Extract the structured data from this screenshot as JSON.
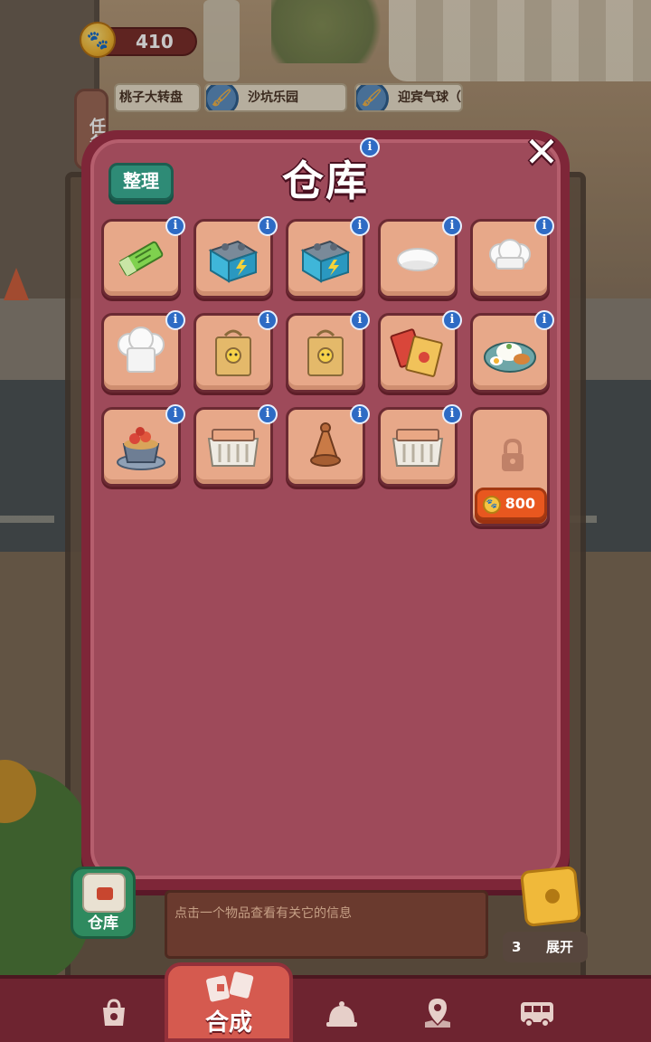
{
  "hud": {
    "coins": "410"
  },
  "tasks": {
    "tab_label": "任务",
    "banners": [
      {
        "label": "桃子大转盘"
      },
      {
        "label": "沙坑乐园"
      },
      {
        "label": "迎宾气球（左"
      }
    ]
  },
  "warehouse": {
    "title": "仓库",
    "sort_label": "整理",
    "close_label": "✕",
    "info_glyph": "i",
    "items": [
      {
        "name": "gum-pack-item-icon"
      },
      {
        "name": "battery-box-item-icon"
      },
      {
        "name": "battery-box-item-icon"
      },
      {
        "name": "chef-hat-small-item-icon"
      },
      {
        "name": "chef-hat-medium-item-icon"
      },
      {
        "name": "chef-hat-large-item-icon"
      },
      {
        "name": "takeout-bag-item-icon"
      },
      {
        "name": "takeout-bag-item-icon"
      },
      {
        "name": "pepper-packets-item-icon"
      },
      {
        "name": "rice-meal-plate-item-icon"
      },
      {
        "name": "fruit-tart-item-icon"
      },
      {
        "name": "storage-crate-item-icon"
      },
      {
        "name": "clay-lid-item-icon"
      },
      {
        "name": "storage-crate-item-icon"
      }
    ],
    "locked_slot": {
      "unlock_cost": "800"
    }
  },
  "bottom": {
    "warehouse_button_label": "仓库",
    "info_hint": "点击一个物品查看有关它的信息",
    "expand_count": "3",
    "expand_label": "展开"
  },
  "nav": {
    "active_label": "合成",
    "items": [
      {
        "name": "shop-bag-icon"
      },
      {
        "name": "merge-icon"
      },
      {
        "name": "service-bell-icon"
      },
      {
        "name": "map-pin-icon"
      },
      {
        "name": "bus-icon"
      }
    ]
  },
  "colors": {
    "panel": "#7e2638",
    "panel_inner": "#9e4a5a",
    "slot": "#e7a889",
    "sort_button": "#2e8b76",
    "unlock_button": "#e8571f",
    "info_badge": "#2e6bc4"
  }
}
